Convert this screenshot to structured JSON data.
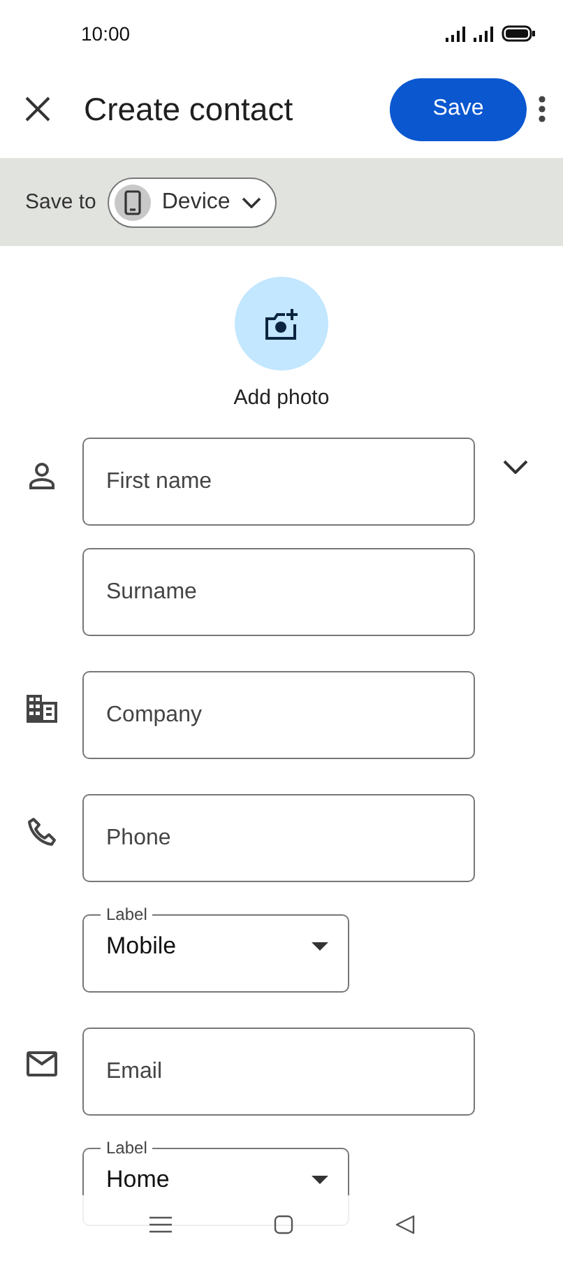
{
  "status_bar": {
    "time": "10:00"
  },
  "toolbar": {
    "title": "Create contact",
    "save_button": "Save"
  },
  "save_to": {
    "label": "Save to",
    "account": "Device"
  },
  "photo": {
    "label": "Add photo"
  },
  "sections": [
    {
      "kind": "person",
      "expandable": true,
      "fields": [
        {
          "kind": "text",
          "placeholder": "First name"
        },
        {
          "kind": "text",
          "placeholder": "Surname"
        }
      ]
    },
    {
      "kind": "company",
      "expandable": false,
      "fields": [
        {
          "kind": "text",
          "placeholder": "Company"
        }
      ]
    },
    {
      "kind": "phone",
      "expandable": false,
      "fields": [
        {
          "kind": "text",
          "placeholder": "Phone"
        },
        {
          "kind": "select",
          "label": "Label",
          "value": "Mobile"
        }
      ]
    },
    {
      "kind": "email",
      "expandable": false,
      "fields": [
        {
          "kind": "text",
          "placeholder": "Email"
        },
        {
          "kind": "select",
          "label": "Label",
          "value": "Home"
        }
      ]
    }
  ]
}
